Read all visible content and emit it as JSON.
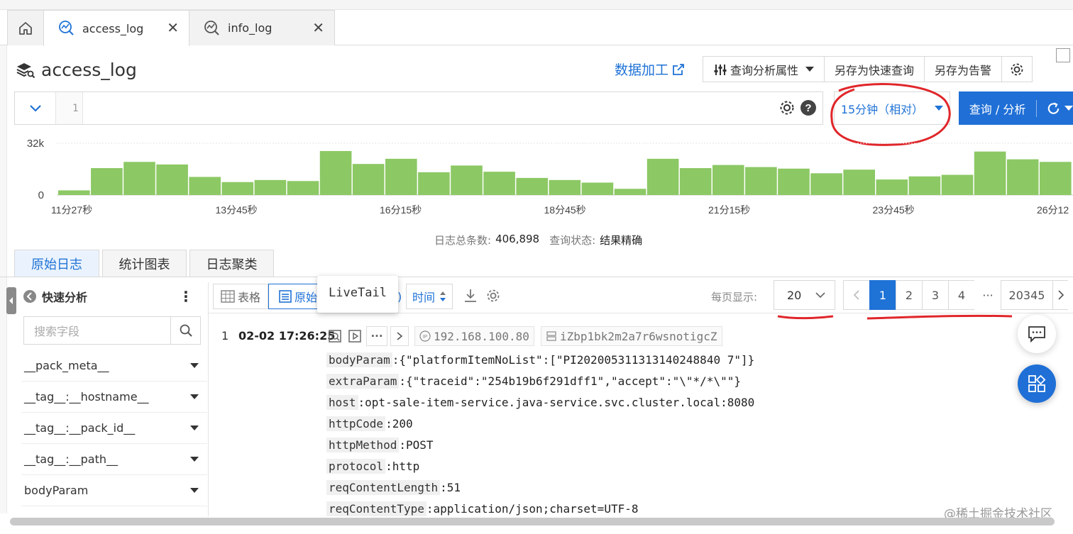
{
  "tabs": [
    {
      "label": "access_log",
      "active": true
    },
    {
      "label": "info_log",
      "active": false
    }
  ],
  "header": {
    "title": "access_log",
    "data_process_link": "数据加工",
    "buttons": [
      "查询分析属性",
      "另存为快速查询",
      "另存为告警"
    ]
  },
  "query": {
    "line_number": "1",
    "time_range": "15分钟（相对）",
    "query_button": "查询 / 分析"
  },
  "histogram": {
    "y_max_label": "32k",
    "y_min_label": "0",
    "x_labels": [
      "11分27秒",
      "13分45秒",
      "16分15秒",
      "18分45秒",
      "21分15秒",
      "23分45秒",
      "26分12"
    ],
    "values": [
      0.09,
      0.52,
      0.64,
      0.59,
      0.35,
      0.25,
      0.29,
      0.27,
      0.85,
      0.6,
      0.7,
      0.44,
      0.57,
      0.45,
      0.33,
      0.29,
      0.24,
      0.12,
      0.7,
      0.52,
      0.58,
      0.54,
      0.51,
      0.42,
      0.49,
      0.3,
      0.36,
      0.39,
      0.84,
      0.69,
      0.64
    ]
  },
  "summary": {
    "total_label": "日志总条数:",
    "total_value": "406,898",
    "status_label": "查询状态:",
    "status_value": "结果精确"
  },
  "result_tabs": [
    "原始日志",
    "统计图表",
    "日志聚类"
  ],
  "left_panel": {
    "title": "快速分析",
    "search_placeholder": "搜索字段",
    "fields": [
      "__pack_meta__",
      "__tag__:__hostname__",
      "__tag__:__pack_id__",
      "__tag__:__path__",
      "bodyParam"
    ]
  },
  "toolbar": {
    "table_label": "表格",
    "raw_label": "原始",
    "time_label": "时间",
    "tooltip": "LiveTail",
    "per_page_label": "每页显示:",
    "per_page_value": "20",
    "pages": [
      "1",
      "2",
      "3",
      "4",
      "···",
      "20345"
    ]
  },
  "log": {
    "index": "1",
    "time": "02-02 17:26:25",
    "ip": "192.168.100.80",
    "host_tag": "iZbp1bk2m2a7r6wsnotigcZ",
    "fields": [
      {
        "k": "bodyParam",
        "v": ":{\"platformItemNoList\":[\"PI202005311313140248840 7\"]}"
      },
      {
        "k": "extraParam",
        "v": ":{\"traceid\":\"254b19b6f291dff1\",\"accept\":\"\\\"*/*\\\"\"}"
      },
      {
        "k": "host",
        "v": ":opt-sale-item-service.java-service.svc.cluster.local:8080"
      },
      {
        "k": "httpCode",
        "v": ":200"
      },
      {
        "k": "httpMethod",
        "v": ":POST"
      },
      {
        "k": "protocol",
        "v": ":http"
      },
      {
        "k": "reqContentLength",
        "v": ":51"
      },
      {
        "k": "reqContentType",
        "v": ":application/json;charset=UTF-8"
      }
    ]
  },
  "watermark": "@稀土掘金技术社区",
  "colors": {
    "accent": "#1f72d6",
    "bar": "#8cc864",
    "annotation": "#e0262a"
  }
}
